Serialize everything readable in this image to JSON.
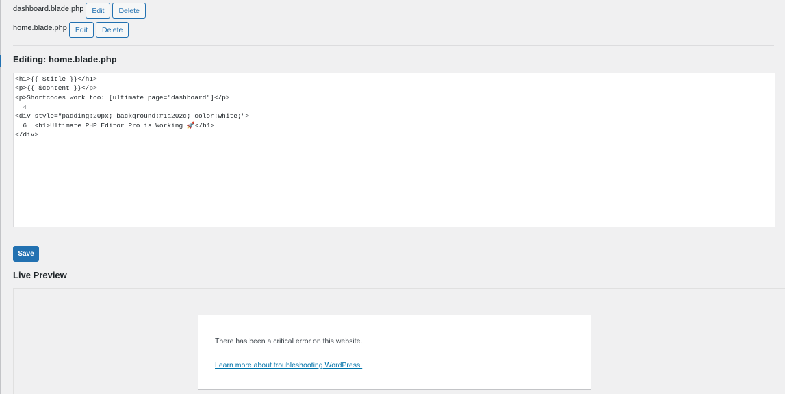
{
  "files": [
    {
      "name": "dashboard.blade.php",
      "edit_label": "Edit",
      "delete_label": "Delete"
    },
    {
      "name": "home.blade.php",
      "edit_label": "Edit",
      "delete_label": "Delete"
    }
  ],
  "editor": {
    "title": "Editing: home.blade.php",
    "lines": [
      "<h1>{{ $title }}</h1>",
      "<p>{{ $content }}</p>",
      "<p>Shortcodes work too: [ultimate page=\"dashboard\"]</p>",
      "  4",
      "<div style=\"padding:20px; background:#1a202c; color:white;\">",
      "  6  <h1>Ultimate PHP Editor Pro is Working 🚀</h1>",
      "</div>"
    ]
  },
  "save_label": "Save",
  "preview": {
    "title": "Live Preview",
    "error_message": "There has been a critical error on this website.",
    "error_link": "Learn more about troubleshooting WordPress."
  },
  "colors": {
    "accent": "#2271b1",
    "background": "#f0f0f1",
    "link": "#0073aa"
  }
}
